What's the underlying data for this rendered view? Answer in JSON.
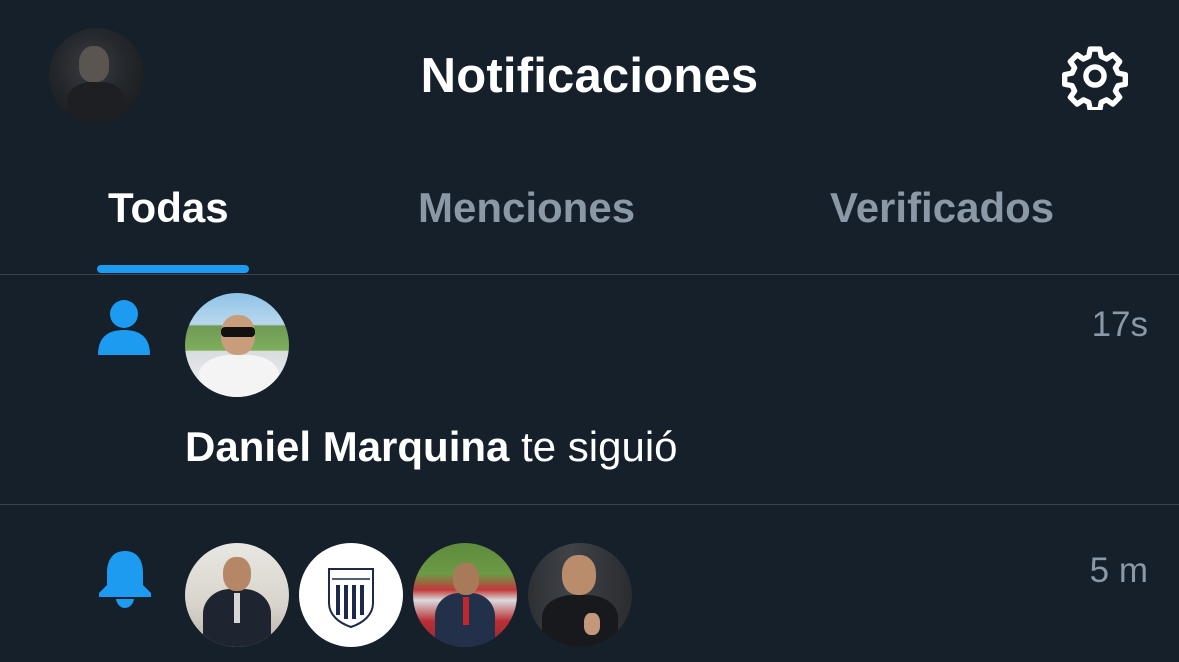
{
  "header": {
    "title": "Notificaciones"
  },
  "tabs": [
    {
      "label": "Todas",
      "active": true
    },
    {
      "label": "Menciones",
      "active": false
    },
    {
      "label": "Verificados",
      "active": false
    }
  ],
  "notifications": [
    {
      "type": "follow",
      "icon": "person-icon",
      "time": "17s",
      "user_name": "Daniel Marquina",
      "action": "te siguió"
    },
    {
      "type": "alert",
      "icon": "bell-icon",
      "time": "5 m"
    }
  ],
  "colors": {
    "background": "#15202b",
    "accent": "#1d9bf0",
    "muted_text": "#8b98a5",
    "divider": "#38444d"
  }
}
